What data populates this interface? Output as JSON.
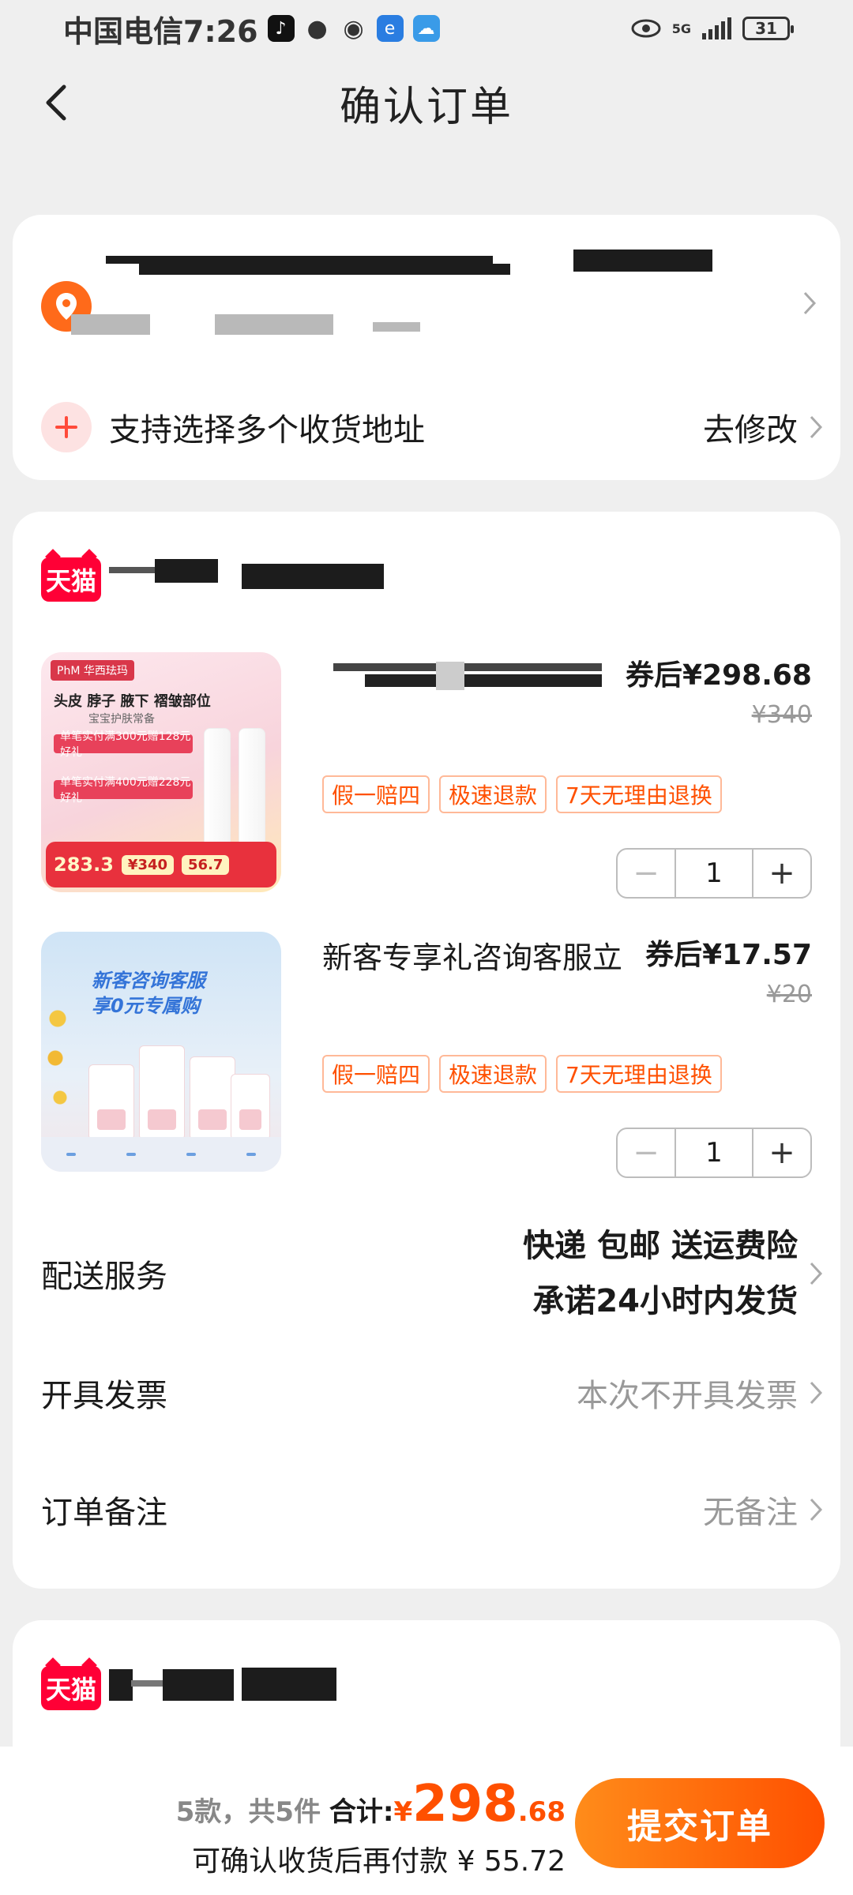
{
  "status_bar": {
    "carrier_time": "中国电信7:26",
    "network": "5G",
    "battery": "31"
  },
  "header": {
    "title": "确认订单"
  },
  "address": {
    "multi_address_label": "支持选择多个收货地址",
    "edit_label": "去修改"
  },
  "shop": {
    "badge": "天猫"
  },
  "products": [
    {
      "title": "",
      "price": "券后¥298.68",
      "original_price": "¥340",
      "tags": [
        "假一赔四",
        "极速退款",
        "7天无理由退换"
      ],
      "quantity": "1",
      "image": {
        "brand": "PhM 华西珐玛",
        "headline": "头皮 脖子 腋下 褶皱部位",
        "sub": "宝宝护肤常备",
        "promo1": "单笔实付满300元赠128元好礼",
        "promo2": "单笔实付满400元赠228元好礼",
        "ref_price": "283.3",
        "chip_price": "¥340",
        "chip2": "56.7"
      }
    },
    {
      "title": "新客专享礼咨询客服立",
      "price": "券后¥17.57",
      "original_price": "¥20",
      "tags": [
        "假一赔四",
        "极速退款",
        "7天无理由退换"
      ],
      "quantity": "1",
      "image": {
        "headline1": "新客咨询客服",
        "headline2": "享0元专属购"
      }
    }
  ],
  "stepper": {
    "minus": "−",
    "plus": "+"
  },
  "delivery": {
    "label": "配送服务",
    "line1": "快递 包邮 送运费险",
    "line2": "承诺24小时内发货"
  },
  "invoice": {
    "label": "开具发票",
    "value": "本次不开具发票"
  },
  "remark": {
    "label": "订单备注",
    "value": "无备注"
  },
  "shop2": {
    "badge": "天猫"
  },
  "footer": {
    "count": "5款，共5件",
    "total_label": "合计:",
    "currency": "¥",
    "total_int": "298",
    "total_dec": ".68",
    "pay_later": "可确认收货后再付款 ¥ 55.72",
    "submit": "提交订单"
  },
  "colors": {
    "accent": "#ff5000",
    "tmall": "#ff0036",
    "pin": "#ff6a1a"
  }
}
